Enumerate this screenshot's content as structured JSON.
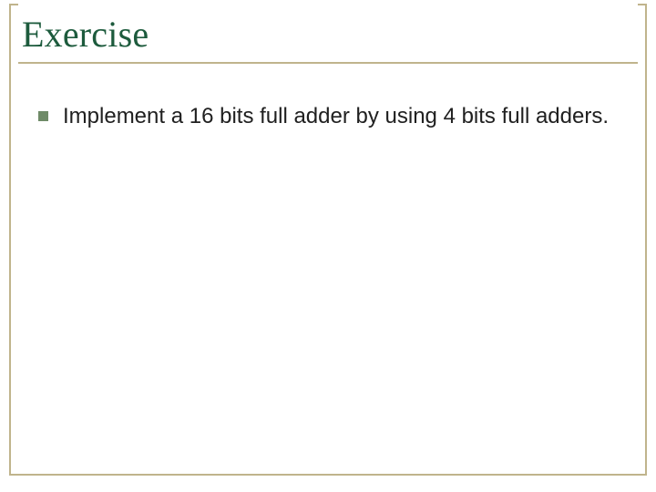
{
  "slide": {
    "title": "Exercise",
    "bullets": [
      "Implement a 16 bits full adder by using 4 bits full adders."
    ]
  },
  "colors": {
    "title": "#1d5b3d",
    "frame": "#c0b48c",
    "bullet": "#6f8b68",
    "text": "#202020"
  }
}
